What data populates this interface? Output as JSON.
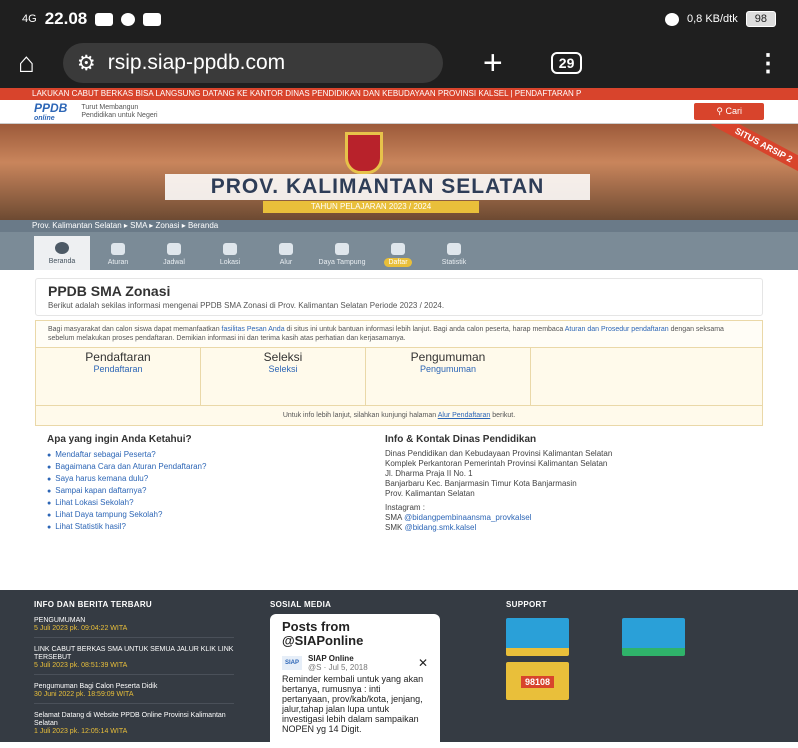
{
  "status": {
    "signal": "4G",
    "time": "22.08",
    "speed": "0,8 KB/dtk",
    "battery": "98"
  },
  "browser": {
    "url": "rsip.siap-ppdb.com",
    "tab_count": "29"
  },
  "marquee": "LAKUKAN CABUT BERKAS BISA LANGSUNG DATANG KE KANTOR DINAS PENDIDIKAN DAN KEBUDAYAAN PROVINSI KALSEL | PENDAFTARAN P",
  "header": {
    "logo": "PPDB",
    "logo_sub": "online",
    "tagline1": "Turut Membangun",
    "tagline2": "Pendidikan untuk Negeri",
    "search_label": "Cari"
  },
  "hero": {
    "title": "PROV. KALIMANTAN SELATAN",
    "year": "TAHUN PELAJARAN 2023 / 2024",
    "ribbon": "SITUS ARSIP 2"
  },
  "breadcrumb": "Prov. Kalimantan Selatan  ▸  SMA  ▸  Zonasi  ▸  Beranda",
  "nav": [
    "Beranda",
    "Aturan",
    "Jadwal",
    "Lokasi",
    "Alur",
    "Daya Tampung",
    "Daftar",
    "Statistik"
  ],
  "page": {
    "title": "PPDB SMA Zonasi",
    "desc": "Berikut adalah sekilas informasi mengenai PPDB SMA Zonasi di Prov. Kalimantan Selatan Periode 2023 / 2024.",
    "info_a": "Bagi masyarakat dan calon siswa dapat memanfaatkan ",
    "info_link1": "fasilitas Pesan Anda",
    "info_b": " di situs ini untuk bantuan informasi lebih lanjut. Bagi anda calon peserta, harap membaca ",
    "info_link2": "Aturan dan Prosedur pendaftaran",
    "info_c": " dengan seksama sebelum melakukan proses pendaftaran. Demikian informasi ini dan terima kasih atas perhatian dan kerjasamanya.",
    "cols": [
      {
        "h": "Pendaftaran",
        "l": "Pendaftaran"
      },
      {
        "h": "Seleksi",
        "l": "Seleksi"
      },
      {
        "h": "Pengumuman",
        "l": "Pengumuman"
      }
    ],
    "note_a": "Untuk info lebih lanjut, silahkan kunjungi halaman ",
    "note_link": "Alur Pendaftaran",
    "note_b": " berikut."
  },
  "faq": {
    "title": "Apa yang ingin Anda Ketahui?",
    "items": [
      "Mendaftar sebagai Peserta?",
      "Bagaimana Cara dan Aturan Pendaftaran?",
      "Saya harus kemana dulu?",
      "Sampai kapan daftarnya?",
      "Lihat Lokasi Sekolah?",
      "Lihat Daya tampung Sekolah?",
      "Lihat Statistik hasil?"
    ]
  },
  "contact": {
    "title": "Info & Kontak Dinas Pendidikan",
    "lines": [
      "Dinas Pendidikan dan Kebudayaan Provinsi Kalimantan Selatan",
      "Komplek Perkantoran Pemerintah Provinsi Kalimantan Selatan",
      "Jl. Dharma Praja II No. 1",
      "Banjarbaru Kec. Banjarmasin Timur Kota Banjarmasin",
      "Prov. Kalimantan Selatan"
    ],
    "ig_label": "Instagram :",
    "sma": "SMA",
    "sma_handle": "@bidangpembinaansma_provkalsel",
    "smk": "SMK",
    "smk_handle": "@bidang.smk.kalsel"
  },
  "footer": {
    "news_title": "INFO DAN BERITA TERBARU",
    "news": [
      {
        "t": "PENGUMUMAN",
        "d": "5 Juli 2023 pk. 09:04:22 WITA"
      },
      {
        "t": "LINK CABUT BERKAS SMA UNTUK SEMUA JALUR KLIK LINK TERSEBUT",
        "d": "5 Juli 2023 pk. 08:51:39 WITA"
      },
      {
        "t": "Pengumuman Bagi Calon Peserta Didik",
        "d": "30 Juni 2022 pk. 18:59:09 WITA"
      },
      {
        "t": "Selamat Datang di Website PPDB Online Provinsi Kalimantan Selatan",
        "d": "1 Juli 2023 pk. 12:05:14 WITA"
      }
    ],
    "social_title": "SOSIAL MEDIA",
    "tweet_head": "Posts from @SIAPonline",
    "tweet_name": "SIAP Online",
    "tweet_meta": "@S · Jul 5, 2018",
    "tweet_body": "Reminder kembali untuk yang akan bertanya, rumusnya : inti pertanyaan, prov/kab/kota, jenjang, jalur,tahap jalan lupa untuk investigasi lebih dalam sampaikan NOPEN yg 14 Digit.",
    "support_title": "SUPPORT",
    "support_number": "98108"
  }
}
